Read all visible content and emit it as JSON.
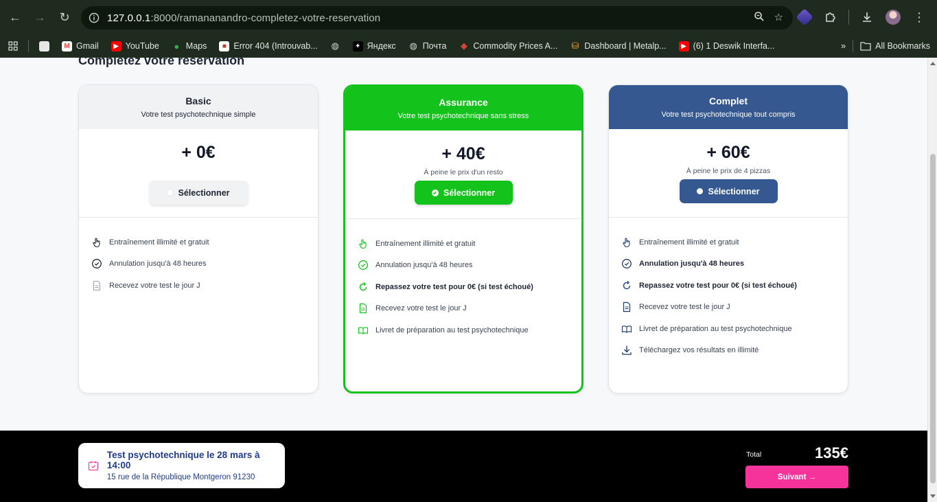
{
  "browser": {
    "url_host": "127.0.0.1",
    "url_path": ":8000/ramananandro-completez-votre-reservation",
    "bookmarks": [
      {
        "label": "",
        "icon": "apps-grid-icon"
      },
      {
        "label": "",
        "icon": "generic-site-icon"
      },
      {
        "label": "Gmail",
        "icon": "gmail-icon",
        "color": "#ea4335"
      },
      {
        "label": "YouTube",
        "icon": "youtube-icon",
        "color": "#ff0000"
      },
      {
        "label": "Maps",
        "icon": "maps-icon",
        "color": "#34a853"
      },
      {
        "label": "Error 404 (Introuvab...",
        "icon": "page-icon",
        "color": "#c53929"
      },
      {
        "label": "",
        "icon": "globe-icon"
      },
      {
        "label": "Яндекс",
        "icon": "yandex-icon",
        "color": "#000000"
      },
      {
        "label": "Почта",
        "icon": "globe-icon"
      },
      {
        "label": "Commodity Prices A...",
        "icon": "commodity-icon",
        "color": "#3f51b5"
      },
      {
        "label": "Dashboard | Metalp...",
        "icon": "dashboard-icon",
        "color": "#f6a623"
      },
      {
        "label": "(6) 1 Deswik Interfa...",
        "icon": "youtube-icon",
        "color": "#ff0000"
      }
    ],
    "more_label": "»",
    "all_bookmarks": "All Bookmarks"
  },
  "page": {
    "heading": "Complétez votre réservation",
    "plans": [
      {
        "name": "Basic",
        "subtitle": "Votre test psychotechnique simple",
        "price": "+ 0€",
        "price_note": "",
        "button": "Sélectionner",
        "selected": false,
        "features": [
          {
            "text": "Entraînement illimité et gratuit",
            "icon": "hand-pointer-icon",
            "bold": false
          },
          {
            "text": "Annulation jusqu'à 48 heures",
            "icon": "check-circle-icon",
            "bold": false
          },
          {
            "text": "Recevez votre test le jour J",
            "icon": "document-icon",
            "bold": false
          }
        ]
      },
      {
        "name": "Assurance",
        "subtitle": "Votre test psychotechnique sans stress",
        "price": "+ 40€",
        "price_note": "À peine le prix d'un resto",
        "button": "Sélectionner",
        "selected": true,
        "features": [
          {
            "text": "Entraînement illimité et gratuit",
            "icon": "hand-pointer-icon",
            "bold": false
          },
          {
            "text": "Annulation jusqu'à 48 heures",
            "icon": "check-circle-icon",
            "bold": false
          },
          {
            "text": "Repassez votre test pour 0€ (si test échoué)",
            "icon": "refresh-icon",
            "bold": true
          },
          {
            "text": "Recevez votre test le jour J",
            "icon": "document-icon",
            "bold": false
          },
          {
            "text": "Livret de préparation au test psychotechnique",
            "icon": "book-icon",
            "bold": false
          }
        ]
      },
      {
        "name": "Complet",
        "subtitle": "Votre test psychotechnique tout compris",
        "price": "+ 60€",
        "price_note": "À peine le prix de 4 pizzas",
        "button": "Sélectionner",
        "selected": false,
        "features": [
          {
            "text": "Entraînement illimité et gratuit",
            "icon": "hand-pointer-icon",
            "bold": false
          },
          {
            "text": "Annulation jusqu'à 48 heures",
            "icon": "check-circle-icon",
            "bold": true
          },
          {
            "text": "Repassez votre test pour 0€ (si test échoué)",
            "icon": "refresh-icon",
            "bold": true
          },
          {
            "text": "Recevez votre test le jour J",
            "icon": "document-icon",
            "bold": false
          },
          {
            "text": "Livret de préparation au test psychotechnique",
            "icon": "book-icon",
            "bold": false
          },
          {
            "text": "Téléchargez vos résultats en illimité",
            "icon": "download-icon",
            "bold": false
          }
        ]
      }
    ]
  },
  "footer": {
    "session_title": "Test psychotechnique le 28 mars à 14:00",
    "session_address": "15 rue de la République Montgeron 91230",
    "total_label": "Total",
    "total_value": "135€",
    "next_button": "Suivant →"
  },
  "colors": {
    "assurance": "#13c21a",
    "complet": "#34588f",
    "next": "#f5339a"
  }
}
